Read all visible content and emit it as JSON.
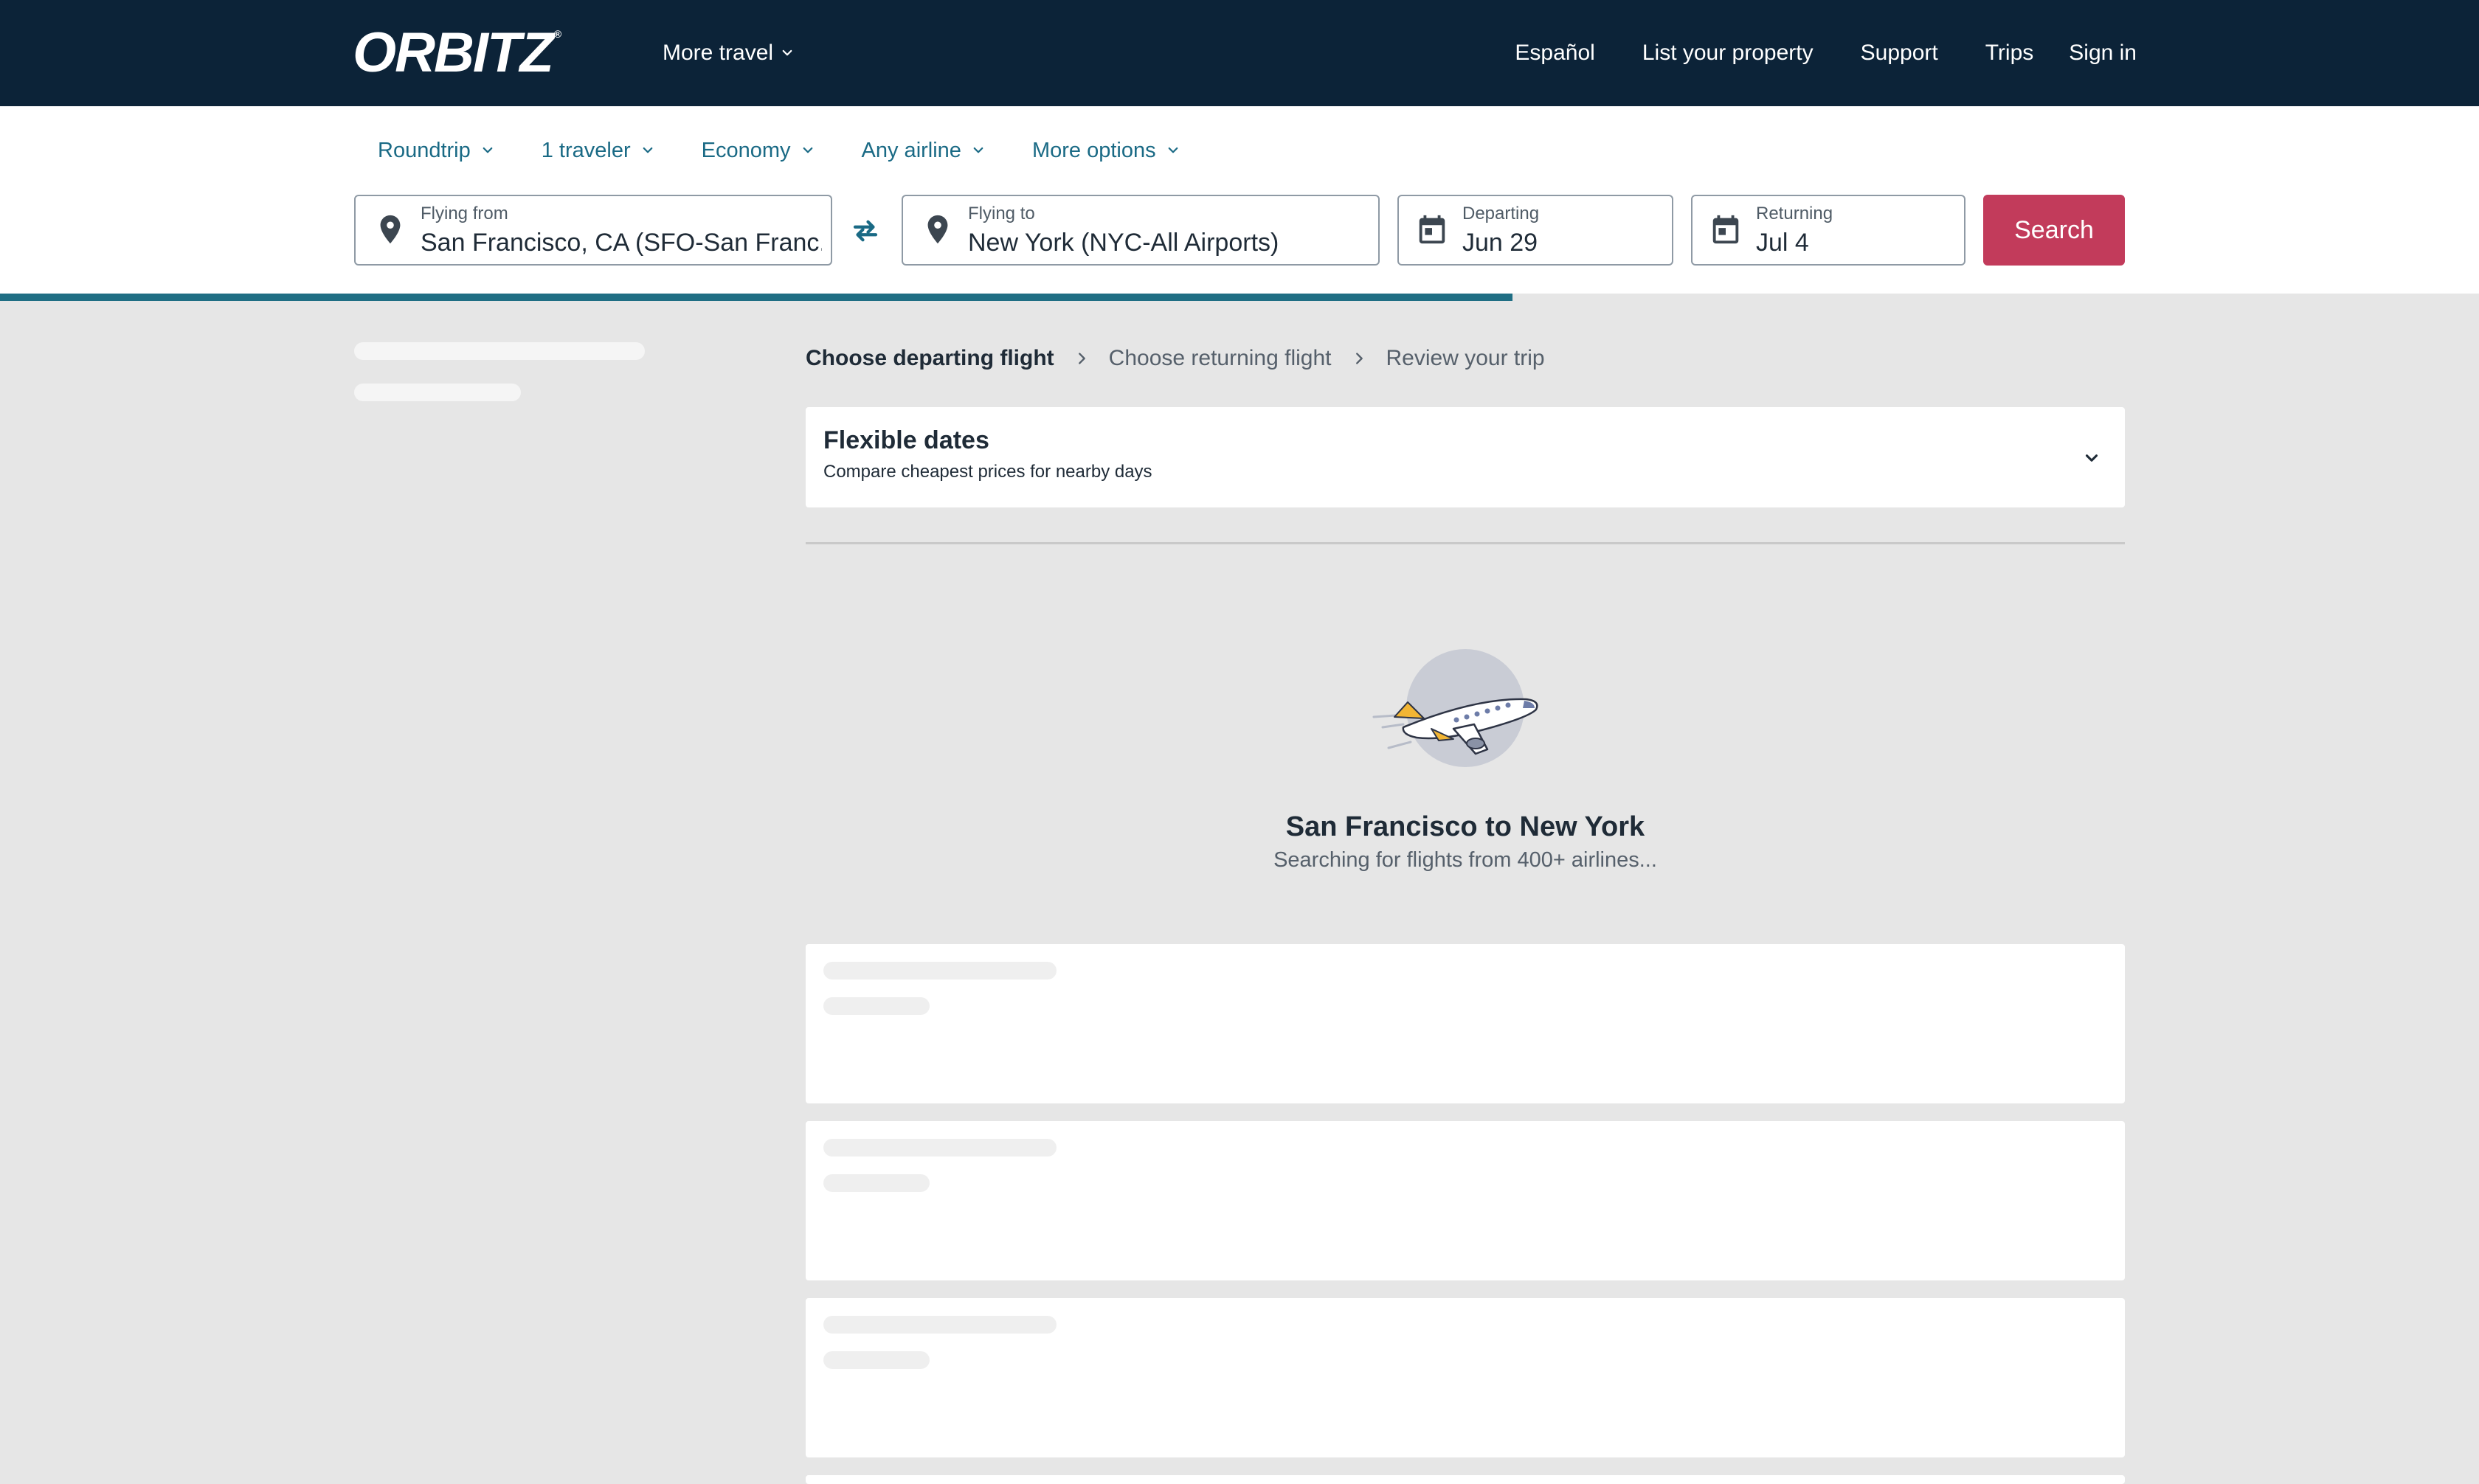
{
  "brand": {
    "logo": "ORBITZ",
    "reg_mark": "®"
  },
  "header": {
    "more_travel": "More travel",
    "links": [
      "Español",
      "List your property",
      "Support",
      "Trips",
      "Sign in"
    ]
  },
  "search": {
    "options": [
      "Roundtrip",
      "1 traveler",
      "Economy",
      "Any airline",
      "More options"
    ],
    "from": {
      "label": "Flying from",
      "value": "San Francisco, CA (SFO-San Franc..."
    },
    "to": {
      "label": "Flying to",
      "value": "New York (NYC-All Airports)"
    },
    "departing": {
      "label": "Departing",
      "value": "Jun 29"
    },
    "returning": {
      "label": "Returning",
      "value": "Jul 4"
    },
    "button": "Search",
    "progress_fraction": 0.61
  },
  "breadcrumb": {
    "steps": [
      "Choose departing flight",
      "Choose returning flight",
      "Review your trip"
    ]
  },
  "flexible": {
    "title": "Flexible dates",
    "subtitle": "Compare cheapest prices for nearby days"
  },
  "loading": {
    "title": "San Francisco to New York",
    "subtitle": "Searching for flights from 400+ airlines..."
  },
  "colors": {
    "nav_bg": "#0c2338",
    "link_teal": "#1a6a85",
    "search_button": "#c23b5b",
    "progress": "#1f6e84",
    "page_bg": "#e6e6e6"
  },
  "icons": {
    "from": "map-pin-icon",
    "to": "map-pin-icon",
    "dates": "calendar-icon",
    "swap": "swap-arrows-icon",
    "dropdown": "chevron-down-icon",
    "breadcrumb_sep": "chevron-right-icon",
    "loading": "airplane-icon"
  }
}
